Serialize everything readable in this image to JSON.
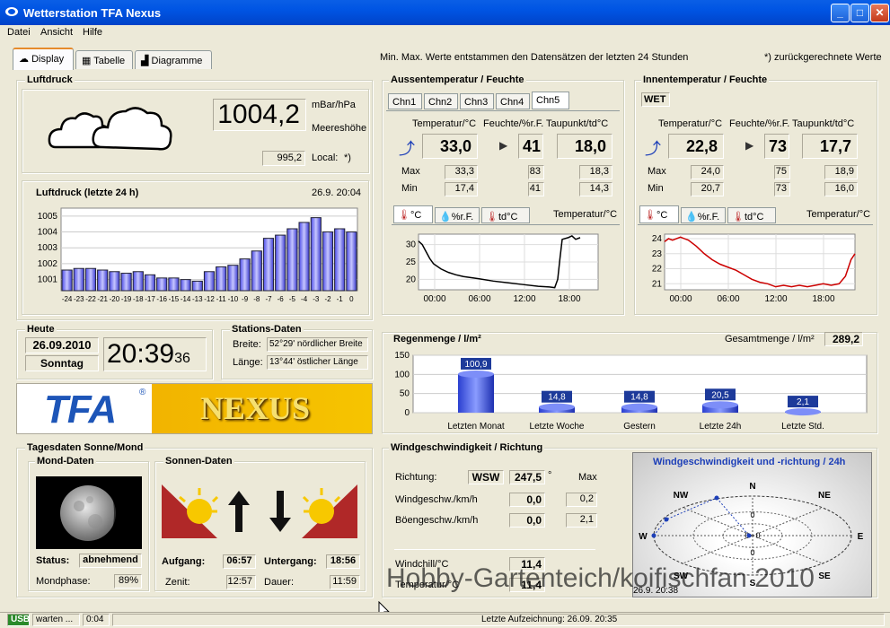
{
  "window": {
    "title": "Wetterstation TFA Nexus",
    "min": "_",
    "max": "□",
    "close": "✕"
  },
  "menu": [
    "Datei",
    "Ansicht",
    "Hilfe"
  ],
  "tabs": [
    "Display",
    "Tabelle",
    "Diagramme"
  ],
  "info": {
    "minmax": "Min. Max. Werte entstammen den Datensätzen der letzten 24 Stunden",
    "calc": "*) zurückgerechnete Werte"
  },
  "luftdruck": {
    "title": "Luftdruck",
    "value": "1004,2",
    "unit": "mBar/hPa",
    "meereshoehe": "Meereshöhe",
    "local_value": "995,2",
    "local_label": "Local:",
    "local_note": "*)"
  },
  "druckchart": {
    "title": "Luftdruck (letzte 24 h)",
    "stamp": "26.9. 20:04"
  },
  "chart_data": [
    {
      "type": "bar",
      "title": "Luftdruck (letzte 24 h)",
      "categories": [
        "-24",
        "-23",
        "-22",
        "-21",
        "-20",
        "-19",
        "-18",
        "-17",
        "-16",
        "-15",
        "-14",
        "-13",
        "-12",
        "-11",
        "-10",
        "-9",
        "-8",
        "-7",
        "-6",
        "-5",
        "-4",
        "-3",
        "-2",
        "-1",
        "0"
      ],
      "values": [
        1001.6,
        1001.7,
        1001.7,
        1001.6,
        1001.5,
        1001.4,
        1001.5,
        1001.3,
        1001.1,
        1001.1,
        1001.0,
        1000.9,
        1001.5,
        1001.8,
        1001.9,
        1002.3,
        1002.8,
        1003.6,
        1003.8,
        1004.2,
        1004.6,
        1004.9,
        1004.0,
        1004.2,
        1004.0
      ],
      "ylim": [
        1000.3,
        1005.5
      ],
      "yticks": [
        "1005",
        "1004",
        "1003",
        "1002",
        "1001"
      ]
    },
    {
      "type": "line",
      "title": "Temperatur/°C",
      "x": [
        "00:00",
        "06:00",
        "12:00",
        "18:00"
      ],
      "ylabel_ticks": [
        "30",
        "25",
        "20"
      ],
      "ylim": [
        17,
        33
      ]
    },
    {
      "type": "line",
      "title": "Temperatur/°C",
      "x": [
        "00:00",
        "06:00",
        "12:00",
        "18:00"
      ],
      "ylabel_ticks": [
        "24",
        "23",
        "22",
        "21"
      ],
      "ylim": [
        20.6,
        24.3
      ]
    },
    {
      "type": "bar",
      "title": "Regenmenge / l/m²",
      "categories": [
        "Letzten Monat",
        "Letzte Woche",
        "Gestern",
        "Letzte 24h",
        "Letzte Std."
      ],
      "values": [
        100.9,
        14.8,
        14.8,
        20.5,
        2.1
      ],
      "labels": [
        "100,9",
        "14,8",
        "14,8",
        "20,5",
        "2,1"
      ],
      "ylim": [
        0,
        150
      ],
      "yticks": [
        "150",
        "100",
        "50",
        "0"
      ]
    }
  ],
  "aussen": {
    "title": "Aussentemperatur / Feuchte",
    "channels": [
      "Chn1",
      "Chn2",
      "Chn3",
      "Chn4",
      "Chn5"
    ],
    "h_temp": "Temperatur/°C",
    "h_feuchte": "Feuchte/%r.F.",
    "h_taupunkt": "Taupunkt/td°C",
    "temp": "33,0",
    "feuchte": "41",
    "taupunkt": "18,0",
    "max_label": "Max",
    "min_label": "Min",
    "max": [
      "33,3",
      "83",
      "18,3"
    ],
    "min": [
      "17,4",
      "41",
      "14,3"
    ],
    "subtabs": [
      "°C",
      "%r.F.",
      "td°C"
    ],
    "chartlabel": "Temperatur/°C"
  },
  "innen": {
    "title": "Innentemperatur / Feuchte",
    "tag": "WET",
    "h_temp": "Temperatur/°C",
    "h_feuchte": "Feuchte/%r.F.",
    "h_taupunkt": "Taupunkt/td°C",
    "temp": "22,8",
    "feuchte": "73",
    "taupunkt": "17,7",
    "max_label": "Max",
    "min_label": "Min",
    "max": [
      "24,0",
      "75",
      "18,9"
    ],
    "min": [
      "20,7",
      "73",
      "16,0"
    ],
    "subtabs": [
      "°C",
      "%r.F.",
      "td°C"
    ],
    "chartlabel": "Temperatur/°C"
  },
  "heute": {
    "title": "Heute",
    "date": "26.09.2010",
    "day": "Sonntag",
    "time": "20:39",
    "sec": "36"
  },
  "stations": {
    "title": "Stations-Daten",
    "breite_label": "Breite:",
    "breite": "52°29' nördlicher Breite",
    "laenge_label": "Länge:",
    "laenge": "13°44' östlicher Länge"
  },
  "logo": {
    "tfa": "TFA",
    "reg": "®",
    "nexus": "NEXUS"
  },
  "regen": {
    "title": "Regenmenge / l/m²",
    "gesamt_label": "Gesamtmenge / l/m²",
    "gesamt": "289,2"
  },
  "sonne": {
    "title": "Tagesdaten Sonne/Mond",
    "mond_title": "Mond-Daten",
    "status_label": "Status:",
    "status": "abnehmend",
    "phase_label": "Mondphase:",
    "phase": "89%",
    "sonnen_title": "Sonnen-Daten",
    "aufgang_label": "Aufgang:",
    "aufgang": "06:57",
    "untergang_label": "Untergang:",
    "untergang": "18:56",
    "zenit_label": "Zenit:",
    "zenit": "12:57",
    "dauer_label": "Dauer:",
    "dauer": "11:59"
  },
  "wind": {
    "title": "Windgeschwindigkeit / Richtung",
    "richtung_label": "Richtung:",
    "richtung": "WSW",
    "grad": "247,5",
    "grad_unit": "°",
    "max_label": "Max",
    "geschw_label": "Windgeschw./km/h",
    "geschw": "0,0",
    "geschw_max": "0,2",
    "boeen_label": "Böengeschw./km/h",
    "boeen": "0,0",
    "boeen_max": "2,1",
    "chill_label": "Windchill/°C",
    "chill": "11,4",
    "temp_label": "Temperatur/°C",
    "temp": "11,4",
    "rose_title": "Windgeschwindigkeit und -richtung / 24h",
    "dirs": [
      "N",
      "NE",
      "E",
      "SE",
      "S",
      "SW",
      "W",
      "NW"
    ],
    "zero": "0",
    "stamp": "26.9. 20:38"
  },
  "watermark": "Hobby-Gartenteich/koifischfan 2010",
  "statusbar": {
    "usb": "USB",
    "warten": "warten ...",
    "time": "0:04",
    "last": "Letzte Aufzeichnung: 26.09. 20:35"
  }
}
